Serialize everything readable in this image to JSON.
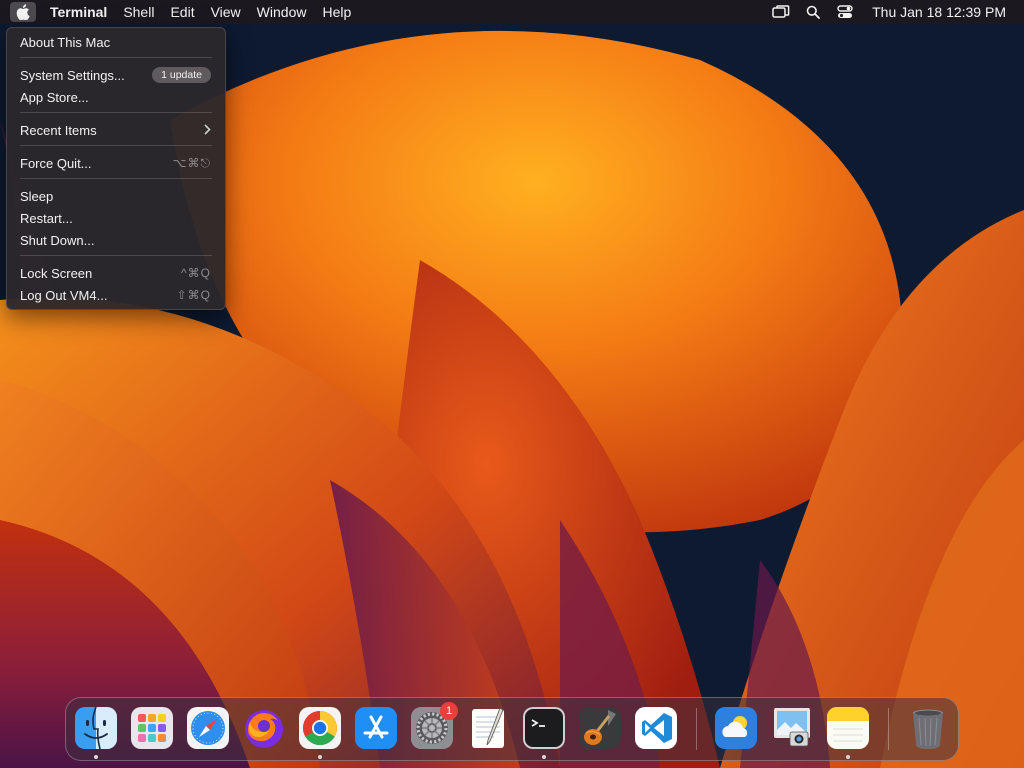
{
  "menubar": {
    "app_name": "Terminal",
    "menus": [
      "Shell",
      "Edit",
      "View",
      "Window",
      "Help"
    ],
    "clock": "Thu Jan 18  12:39 PM"
  },
  "apple_menu": {
    "about": "About This Mac",
    "system_settings": "System Settings...",
    "system_settings_badge": "1 update",
    "app_store": "App Store...",
    "recent_items": "Recent Items",
    "force_quit": "Force Quit...",
    "force_quit_shortcut": "⌥⌘⎋",
    "sleep": "Sleep",
    "restart": "Restart...",
    "shut_down": "Shut Down...",
    "lock_screen": "Lock Screen",
    "lock_screen_shortcut": "^⌘Q",
    "log_out": "Log Out VM4...",
    "log_out_shortcut": "⇧⌘Q"
  },
  "dock": {
    "apps": [
      {
        "icon": "finder-icon",
        "running": true
      },
      {
        "icon": "launchpad-icon",
        "running": false
      },
      {
        "icon": "safari-icon",
        "running": false
      },
      {
        "icon": "firefox-icon",
        "running": false
      },
      {
        "icon": "chrome-icon",
        "running": true
      },
      {
        "icon": "app-store-icon",
        "running": false
      },
      {
        "icon": "system-settings-icon",
        "running": false,
        "badge": "1"
      },
      {
        "icon": "textedit-icon",
        "running": false
      },
      {
        "icon": "terminal-icon",
        "running": true
      },
      {
        "icon": "garageband-icon",
        "running": false
      },
      {
        "icon": "vscode-icon",
        "running": false
      },
      {
        "icon": "weather-icon",
        "running": false
      },
      {
        "icon": "preview-icon",
        "running": false
      },
      {
        "icon": "notes-icon",
        "running": true
      },
      {
        "icon": "trash-icon",
        "running": false
      }
    ]
  },
  "colors": {
    "menu_bg": "#2c282c",
    "badge_red": "#e8403a",
    "wallpaper_orange": "#e8661a"
  }
}
